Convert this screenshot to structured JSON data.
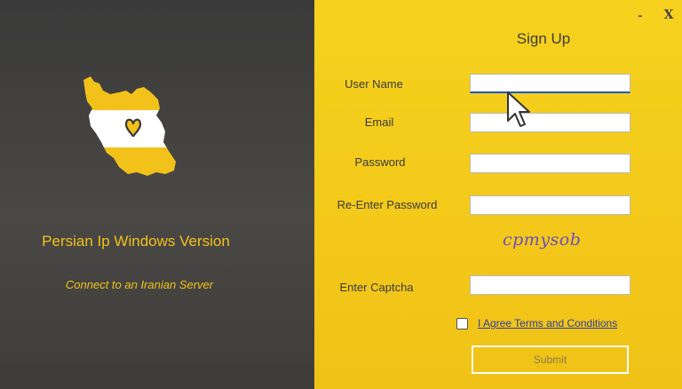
{
  "window": {
    "minimize_label": "-",
    "close_label": "X"
  },
  "branding": {
    "app_title": "Persian Ip Windows Version",
    "subtitle": "Connect to an Iranian Server",
    "logo_icon": "iran-map-heart-icon"
  },
  "form": {
    "title": "Sign Up",
    "fields": {
      "username_label": "User Name",
      "username_value": "",
      "email_label": "Email",
      "email_value": "",
      "password_label": "Password",
      "password_value": "",
      "reenter_label": "Re-Enter Password",
      "reenter_value": "",
      "captcha_label": "Enter Captcha",
      "captcha_value": ""
    },
    "captcha_text": "cpmysob",
    "agree_label": "I Agree Terms and Conditions",
    "agree_checked": false,
    "submit_label": "Submit"
  },
  "colors": {
    "left_panel_bg": "#3e3e3e",
    "right_panel_bg": "#f4cc1c",
    "accent_yellow": "#f2c21a"
  }
}
